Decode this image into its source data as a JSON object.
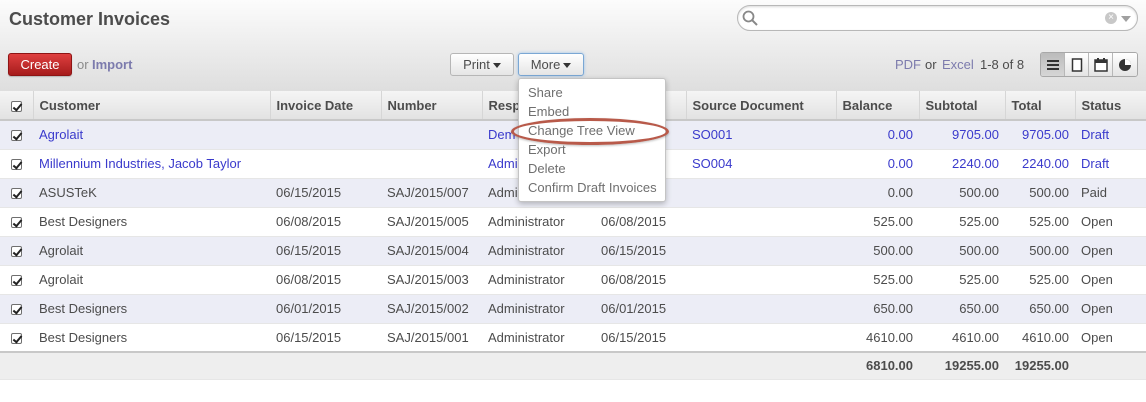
{
  "header": {
    "title": "Customer Invoices",
    "search": {
      "placeholder": ""
    }
  },
  "toolbar": {
    "create_label": "Create",
    "or_label": "or",
    "import_label": "Import",
    "print_label": "Print",
    "more_label": "More",
    "pdf_label": "PDF",
    "or2_label": "or",
    "excel_label": "Excel",
    "pager_text": "1-8 of 8",
    "views": [
      "list-view-icon",
      "form-view-icon",
      "calendar-view-icon",
      "graph-view-icon"
    ]
  },
  "more_menu": {
    "items": [
      "Share",
      "Embed",
      "Change Tree View",
      "Export",
      "Delete",
      "Confirm Draft Invoices"
    ],
    "highlighted": "Change Tree View"
  },
  "table": {
    "columns": [
      "Customer",
      "Invoice Date",
      "Number",
      "Resp",
      "",
      "Source Document",
      "Balance",
      "Subtotal",
      "Total",
      "Status"
    ],
    "rows": [
      {
        "customer": "Agrolait",
        "invoice_date": "",
        "number": "",
        "responsible": "Dem",
        "due_date": "",
        "source": "SO001",
        "balance": "0.00",
        "subtotal": "9705.00",
        "total": "9705.00",
        "status": "Draft",
        "draft": true
      },
      {
        "customer": "Millennium Industries, Jacob Taylor",
        "invoice_date": "",
        "number": "",
        "responsible": "Admi",
        "due_date": "",
        "source": "SO004",
        "balance": "0.00",
        "subtotal": "2240.00",
        "total": "2240.00",
        "status": "Draft",
        "draft": true
      },
      {
        "customer": "ASUSTeK",
        "invoice_date": "06/15/2015",
        "number": "SAJ/2015/007",
        "responsible": "Admi",
        "due_date": "",
        "source": "",
        "balance": "0.00",
        "subtotal": "500.00",
        "total": "500.00",
        "status": "Paid",
        "draft": false
      },
      {
        "customer": "Best Designers",
        "invoice_date": "06/08/2015",
        "number": "SAJ/2015/005",
        "responsible": "Administrator",
        "due_date": "06/08/2015",
        "source": "",
        "balance": "525.00",
        "subtotal": "525.00",
        "total": "525.00",
        "status": "Open",
        "draft": false
      },
      {
        "customer": "Agrolait",
        "invoice_date": "06/15/2015",
        "number": "SAJ/2015/004",
        "responsible": "Administrator",
        "due_date": "06/15/2015",
        "source": "",
        "balance": "500.00",
        "subtotal": "500.00",
        "total": "500.00",
        "status": "Open",
        "draft": false
      },
      {
        "customer": "Agrolait",
        "invoice_date": "06/08/2015",
        "number": "SAJ/2015/003",
        "responsible": "Administrator",
        "due_date": "06/08/2015",
        "source": "",
        "balance": "525.00",
        "subtotal": "525.00",
        "total": "525.00",
        "status": "Open",
        "draft": false
      },
      {
        "customer": "Best Designers",
        "invoice_date": "06/01/2015",
        "number": "SAJ/2015/002",
        "responsible": "Administrator",
        "due_date": "06/01/2015",
        "source": "",
        "balance": "650.00",
        "subtotal": "650.00",
        "total": "650.00",
        "status": "Open",
        "draft": false
      },
      {
        "customer": "Best Designers",
        "invoice_date": "06/15/2015",
        "number": "SAJ/2015/001",
        "responsible": "Administrator",
        "due_date": "06/15/2015",
        "source": "",
        "balance": "4610.00",
        "subtotal": "4610.00",
        "total": "4610.00",
        "status": "Open",
        "draft": false
      }
    ],
    "totals": {
      "balance": "6810.00",
      "subtotal": "19255.00",
      "total": "19255.00"
    }
  },
  "colors": {
    "create_button": "#c62828",
    "link": "#7c7bad",
    "draft_text": "#3a3acc",
    "odd_row": "#ecedf6",
    "highlight_oval": "#b85a4a"
  }
}
